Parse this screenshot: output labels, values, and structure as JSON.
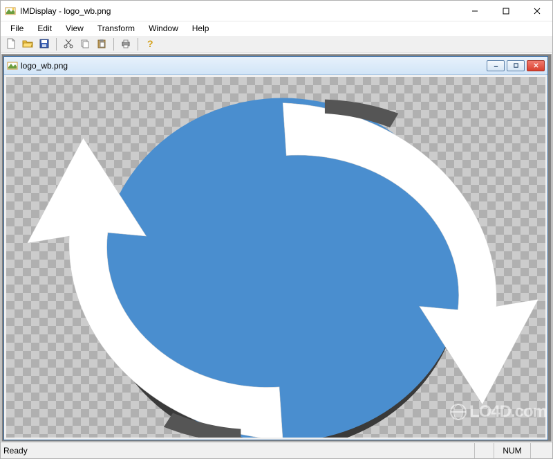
{
  "window": {
    "title": "IMDisplay - logo_wb.png"
  },
  "menu": {
    "items": [
      "File",
      "Edit",
      "View",
      "Transform",
      "Window",
      "Help"
    ]
  },
  "toolbar": {
    "new": "new-file-icon",
    "open": "open-folder-icon",
    "save": "save-disk-icon",
    "cut": "cut-scissors-icon",
    "copy": "copy-icon",
    "paste": "paste-icon",
    "print": "printer-icon",
    "help": "help-question-icon"
  },
  "document": {
    "title": "logo_wb.png"
  },
  "status": {
    "left": "Ready",
    "indicator": "NUM"
  },
  "watermark": {
    "text": "LO4D.com"
  },
  "colors": {
    "accent": "#3b7fc4"
  }
}
